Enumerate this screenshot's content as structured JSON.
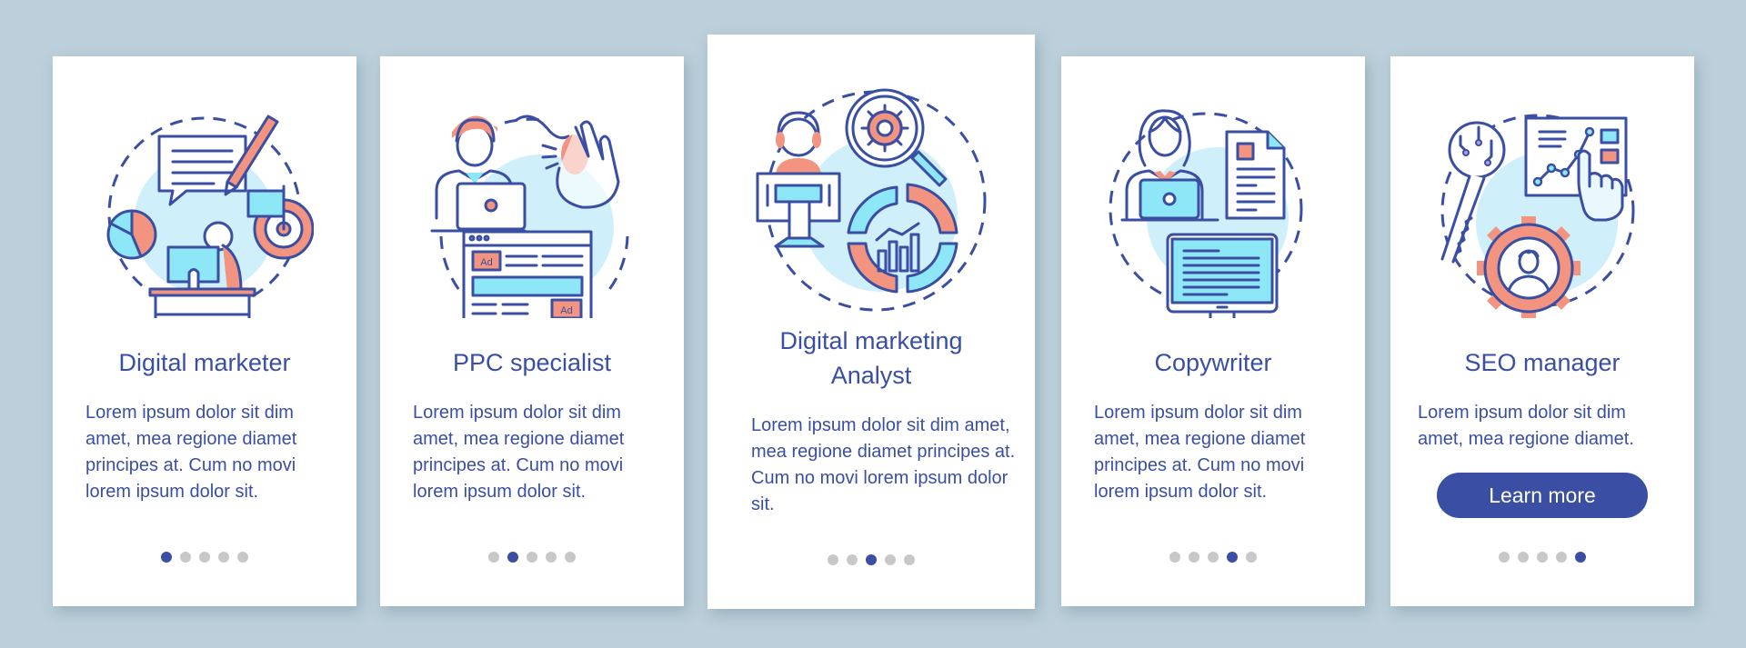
{
  "colors": {
    "background": "#bccfda",
    "card": "#ffffff",
    "accent": "#3a4fa3",
    "dot_inactive": "#c8c8c8",
    "illustration_cyan": "#8ee7f7",
    "illustration_orange": "#f29480",
    "illustration_light": "#cfeffa"
  },
  "cards": [
    {
      "illustration": "digital-marketer-illustration",
      "title": "Digital marketer",
      "body": "Lorem ipsum dolor sit dim amet, mea regione diamet principes at. Cum no movi lorem ipsum dolor sit.",
      "active_page": 1,
      "page_count": 5
    },
    {
      "illustration": "ppc-specialist-illustration",
      "title": "PPC specialist",
      "body": "Lorem ipsum dolor sit dim amet, mea regione diamet principes at. Cum no movi lorem ipsum dolor sit.",
      "ad_label": "Ad",
      "active_page": 2,
      "page_count": 5
    },
    {
      "illustration": "digital-marketing-analyst-illustration",
      "title": "Digital marketing Analyst",
      "title_line1": "Digital marketing",
      "title_line2": "Analyst",
      "body": "Lorem ipsum dolor sit dim amet, mea regione diamet principes at. Cum no movi lorem ipsum dolor sit.",
      "active_page": 3,
      "page_count": 5
    },
    {
      "illustration": "copywriter-illustration",
      "title": "Copywriter",
      "body": "Lorem ipsum dolor sit dim amet, mea regione diamet principes at. Cum no movi lorem ipsum dolor sit.",
      "active_page": 4,
      "page_count": 5
    },
    {
      "illustration": "seo-manager-illustration",
      "title": "SEO manager",
      "body": "Lorem ipsum dolor sit dim amet, mea regione diamet.",
      "button_label": "Learn more",
      "active_page": 5,
      "page_count": 5
    }
  ]
}
